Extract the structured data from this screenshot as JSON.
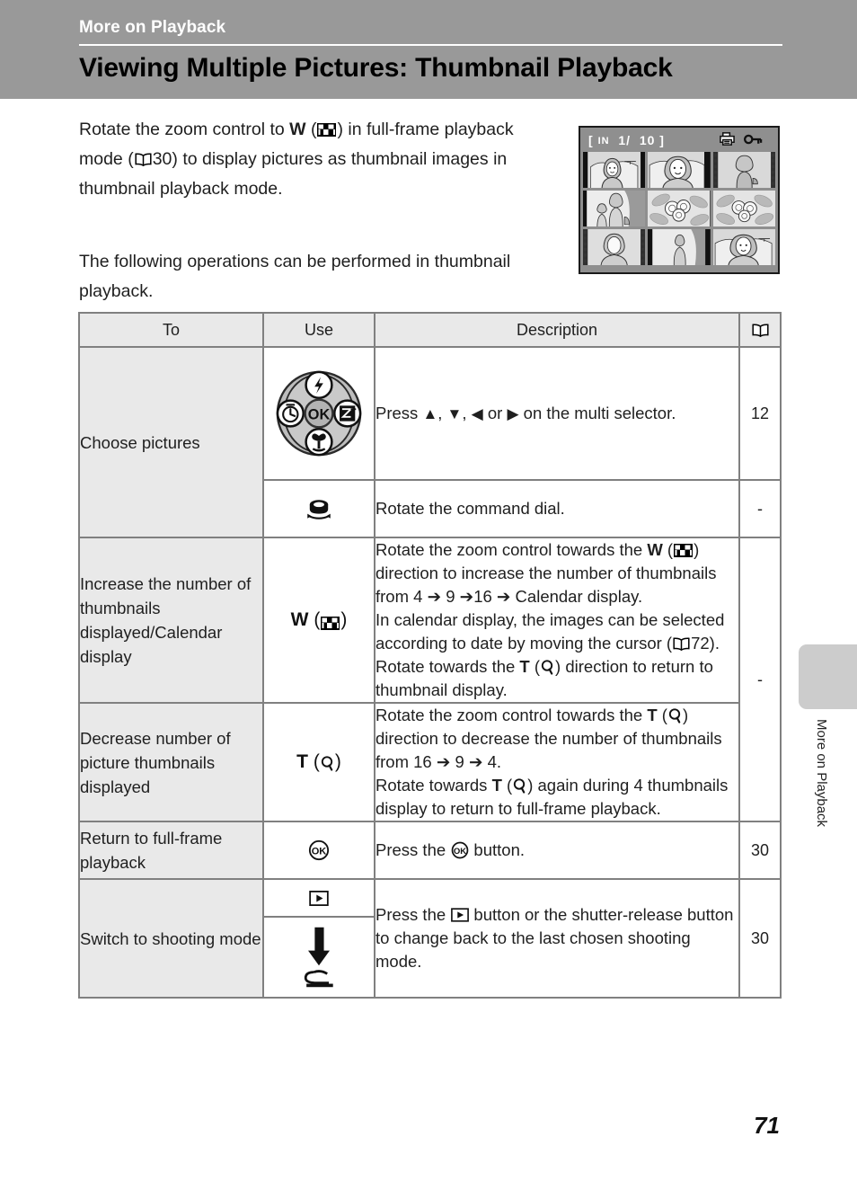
{
  "header": {
    "chapter_label": "More on Playback",
    "title": "Viewing Multiple Pictures: Thumbnail Playback",
    "band_color": "#999999"
  },
  "intro": {
    "para1_before": "Rotate the zoom control to ",
    "para1_w": "W",
    "para1_mid": ") in full-frame playback mode (",
    "para1_ref": "30",
    "para1_after": ") to display pictures as thumbnail images in thumbnail playback mode.",
    "para2": "The following operations can be performed in thumbnail playback."
  },
  "lcd": {
    "storage_tag": "IN",
    "counter_current": "1/",
    "counter_total": "10",
    "bracket_open": "[",
    "bracket_close": "]",
    "icons": [
      "printer-icon",
      "key-icon"
    ],
    "thumbnail_count": 9,
    "selected_index": 0
  },
  "table": {
    "headers": [
      "To",
      "Use",
      "Description",
      "book-icon"
    ],
    "rows": [
      {
        "to": "Choose pictures",
        "use_icon": "multi-selector-icon",
        "desc_before": "Press ",
        "desc_up": "▲",
        "desc_down": "▼",
        "desc_left": "◀",
        "desc_right": "▶",
        "desc_after": " on the multi selector.",
        "ref": "12"
      },
      {
        "use_icon": "command-dial-icon",
        "desc": "Rotate the command dial.",
        "ref": "-"
      },
      {
        "to": "Increase the number of thumbnails displayed/Calendar display",
        "use_label": "W",
        "use_icon": "thumbnail-4-icon",
        "desc_l1a": "Rotate the zoom control towards the ",
        "desc_l1b": "W",
        "desc_l1c": ") direction to increase the number of thumbnails from 4 ",
        "desc_arrow1": "➔",
        "desc_l1d": " 9 ",
        "desc_arrow2": "➔",
        "desc_l1e": "16 ",
        "desc_arrow3": "➔",
        "desc_l1f": " Calendar display.",
        "desc_l2a": "In calendar display, the images can be selected according to date by moving the cursor (",
        "desc_l2ref": "72",
        "desc_l2b": ").",
        "desc_l3a": "Rotate towards the ",
        "desc_l3b": "T",
        "desc_l3c": ") direction to return to thumbnail display.",
        "ref": "-"
      },
      {
        "to": "Decrease number of picture thumbnails displayed",
        "use_label": "T",
        "use_icon": "magnifier-icon",
        "desc_l1a": "Rotate the zoom control towards the ",
        "desc_l1b": "T",
        "desc_l1c": ") direction to decrease the number of thumbnails from 16 ",
        "desc_arrow1": "➔",
        "desc_l1d": " 9 ",
        "desc_arrow2": "➔",
        "desc_l1e": " 4.",
        "desc_l2a": "Rotate towards ",
        "desc_l2b": "T",
        "desc_l2c": ") again during 4 thumbnails display to return to full-frame playback.",
        "ref": ""
      },
      {
        "to": "Return to full-frame playback",
        "use_icon": "ok-button-icon",
        "desc_before": "Press the ",
        "desc_after": " button.",
        "ref": "30"
      },
      {
        "to": "Switch to shooting mode",
        "use_icon_1": "playback-button-icon",
        "use_icon_2": "shutter-release-icon",
        "desc_before": "Press the ",
        "desc_after": " button or the shutter-release button to change back to the last chosen shooting mode.",
        "ref": "30"
      }
    ]
  },
  "margin_tab": {
    "label": "More on Playback",
    "color": "#cccccc"
  },
  "footer": {
    "page_number": "71"
  }
}
